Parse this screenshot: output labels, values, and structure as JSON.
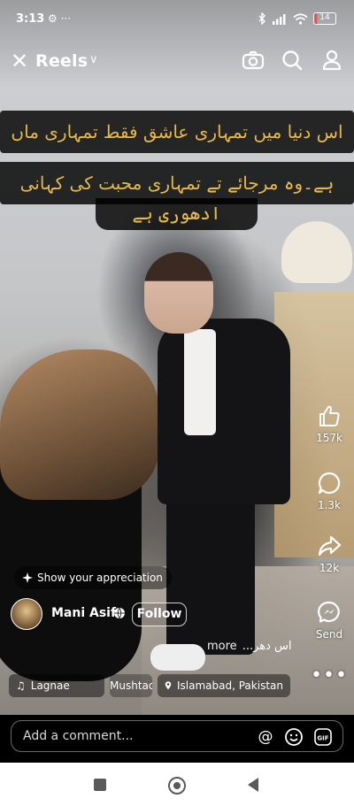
{
  "status_bar": {
    "time": "3:13",
    "left_icons": "⚙ ···",
    "battery": "14",
    "icons": [
      "bluetooth-icon",
      "signal-icon",
      "wifi-icon",
      "battery-icon"
    ]
  },
  "header": {
    "title": "Reels",
    "chevron": "∨",
    "close_glyph": "✕",
    "icons": [
      "close-icon",
      "chevron-down-icon",
      "camera-icon",
      "search-icon",
      "profile-icon"
    ]
  },
  "captions": {
    "line1": "اس دنیا میں تمہاری عاشق فقط تمہاری ماں",
    "line2": "ہے۔وہ مرجائے تے تمہاری محبت کی کہانی",
    "line3": "ادھوری ہے"
  },
  "actions": {
    "likes": "157k",
    "comments": "1.3k",
    "shares": "12k",
    "send_label": "Send",
    "more_glyph": "•••"
  },
  "appreciation": {
    "label": "Show your appreciation",
    "icon": "sparkle-icon"
  },
  "author": {
    "name": "Mani Asif",
    "follow_label": "Follow"
  },
  "description": {
    "text": "اس دھر...",
    "more_label": "more"
  },
  "chips": {
    "music_title": "Lagnae",
    "music_artist": "Mushtaq",
    "location": "Islamabad, Pakistan"
  },
  "comment_bar": {
    "placeholder": "Add a comment...",
    "at_glyph": "@",
    "gif_label": "GIF"
  },
  "colors": {
    "caption_text": "#e8b94a",
    "caption_bg": "#000000",
    "battery_low": "#e25555"
  }
}
